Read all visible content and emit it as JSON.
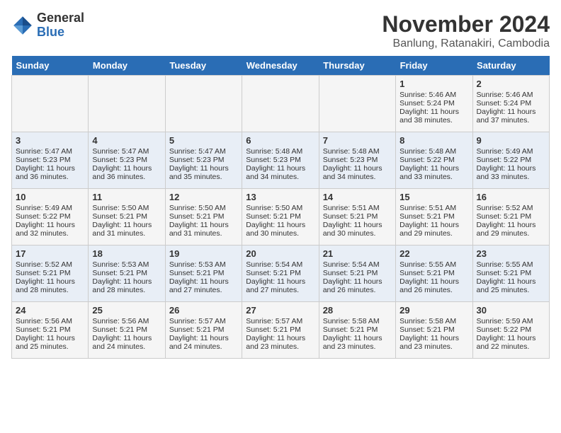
{
  "logo": {
    "general": "General",
    "blue": "Blue"
  },
  "title": "November 2024",
  "subtitle": "Banlung, Ratanakiri, Cambodia",
  "headers": [
    "Sunday",
    "Monday",
    "Tuesday",
    "Wednesday",
    "Thursday",
    "Friday",
    "Saturday"
  ],
  "weeks": [
    [
      {
        "day": "",
        "sunrise": "",
        "sunset": "",
        "daylight": ""
      },
      {
        "day": "",
        "sunrise": "",
        "sunset": "",
        "daylight": ""
      },
      {
        "day": "",
        "sunrise": "",
        "sunset": "",
        "daylight": ""
      },
      {
        "day": "",
        "sunrise": "",
        "sunset": "",
        "daylight": ""
      },
      {
        "day": "",
        "sunrise": "",
        "sunset": "",
        "daylight": ""
      },
      {
        "day": "1",
        "sunrise": "Sunrise: 5:46 AM",
        "sunset": "Sunset: 5:24 PM",
        "daylight": "Daylight: 11 hours and 38 minutes."
      },
      {
        "day": "2",
        "sunrise": "Sunrise: 5:46 AM",
        "sunset": "Sunset: 5:24 PM",
        "daylight": "Daylight: 11 hours and 37 minutes."
      }
    ],
    [
      {
        "day": "3",
        "sunrise": "Sunrise: 5:47 AM",
        "sunset": "Sunset: 5:23 PM",
        "daylight": "Daylight: 11 hours and 36 minutes."
      },
      {
        "day": "4",
        "sunrise": "Sunrise: 5:47 AM",
        "sunset": "Sunset: 5:23 PM",
        "daylight": "Daylight: 11 hours and 36 minutes."
      },
      {
        "day": "5",
        "sunrise": "Sunrise: 5:47 AM",
        "sunset": "Sunset: 5:23 PM",
        "daylight": "Daylight: 11 hours and 35 minutes."
      },
      {
        "day": "6",
        "sunrise": "Sunrise: 5:48 AM",
        "sunset": "Sunset: 5:23 PM",
        "daylight": "Daylight: 11 hours and 34 minutes."
      },
      {
        "day": "7",
        "sunrise": "Sunrise: 5:48 AM",
        "sunset": "Sunset: 5:23 PM",
        "daylight": "Daylight: 11 hours and 34 minutes."
      },
      {
        "day": "8",
        "sunrise": "Sunrise: 5:48 AM",
        "sunset": "Sunset: 5:22 PM",
        "daylight": "Daylight: 11 hours and 33 minutes."
      },
      {
        "day": "9",
        "sunrise": "Sunrise: 5:49 AM",
        "sunset": "Sunset: 5:22 PM",
        "daylight": "Daylight: 11 hours and 33 minutes."
      }
    ],
    [
      {
        "day": "10",
        "sunrise": "Sunrise: 5:49 AM",
        "sunset": "Sunset: 5:22 PM",
        "daylight": "Daylight: 11 hours and 32 minutes."
      },
      {
        "day": "11",
        "sunrise": "Sunrise: 5:50 AM",
        "sunset": "Sunset: 5:21 PM",
        "daylight": "Daylight: 11 hours and 31 minutes."
      },
      {
        "day": "12",
        "sunrise": "Sunrise: 5:50 AM",
        "sunset": "Sunset: 5:21 PM",
        "daylight": "Daylight: 11 hours and 31 minutes."
      },
      {
        "day": "13",
        "sunrise": "Sunrise: 5:50 AM",
        "sunset": "Sunset: 5:21 PM",
        "daylight": "Daylight: 11 hours and 30 minutes."
      },
      {
        "day": "14",
        "sunrise": "Sunrise: 5:51 AM",
        "sunset": "Sunset: 5:21 PM",
        "daylight": "Daylight: 11 hours and 30 minutes."
      },
      {
        "day": "15",
        "sunrise": "Sunrise: 5:51 AM",
        "sunset": "Sunset: 5:21 PM",
        "daylight": "Daylight: 11 hours and 29 minutes."
      },
      {
        "day": "16",
        "sunrise": "Sunrise: 5:52 AM",
        "sunset": "Sunset: 5:21 PM",
        "daylight": "Daylight: 11 hours and 29 minutes."
      }
    ],
    [
      {
        "day": "17",
        "sunrise": "Sunrise: 5:52 AM",
        "sunset": "Sunset: 5:21 PM",
        "daylight": "Daylight: 11 hours and 28 minutes."
      },
      {
        "day": "18",
        "sunrise": "Sunrise: 5:53 AM",
        "sunset": "Sunset: 5:21 PM",
        "daylight": "Daylight: 11 hours and 28 minutes."
      },
      {
        "day": "19",
        "sunrise": "Sunrise: 5:53 AM",
        "sunset": "Sunset: 5:21 PM",
        "daylight": "Daylight: 11 hours and 27 minutes."
      },
      {
        "day": "20",
        "sunrise": "Sunrise: 5:54 AM",
        "sunset": "Sunset: 5:21 PM",
        "daylight": "Daylight: 11 hours and 27 minutes."
      },
      {
        "day": "21",
        "sunrise": "Sunrise: 5:54 AM",
        "sunset": "Sunset: 5:21 PM",
        "daylight": "Daylight: 11 hours and 26 minutes."
      },
      {
        "day": "22",
        "sunrise": "Sunrise: 5:55 AM",
        "sunset": "Sunset: 5:21 PM",
        "daylight": "Daylight: 11 hours and 26 minutes."
      },
      {
        "day": "23",
        "sunrise": "Sunrise: 5:55 AM",
        "sunset": "Sunset: 5:21 PM",
        "daylight": "Daylight: 11 hours and 25 minutes."
      }
    ],
    [
      {
        "day": "24",
        "sunrise": "Sunrise: 5:56 AM",
        "sunset": "Sunset: 5:21 PM",
        "daylight": "Daylight: 11 hours and 25 minutes."
      },
      {
        "day": "25",
        "sunrise": "Sunrise: 5:56 AM",
        "sunset": "Sunset: 5:21 PM",
        "daylight": "Daylight: 11 hours and 24 minutes."
      },
      {
        "day": "26",
        "sunrise": "Sunrise: 5:57 AM",
        "sunset": "Sunset: 5:21 PM",
        "daylight": "Daylight: 11 hours and 24 minutes."
      },
      {
        "day": "27",
        "sunrise": "Sunrise: 5:57 AM",
        "sunset": "Sunset: 5:21 PM",
        "daylight": "Daylight: 11 hours and 23 minutes."
      },
      {
        "day": "28",
        "sunrise": "Sunrise: 5:58 AM",
        "sunset": "Sunset: 5:21 PM",
        "daylight": "Daylight: 11 hours and 23 minutes."
      },
      {
        "day": "29",
        "sunrise": "Sunrise: 5:58 AM",
        "sunset": "Sunset: 5:21 PM",
        "daylight": "Daylight: 11 hours and 23 minutes."
      },
      {
        "day": "30",
        "sunrise": "Sunrise: 5:59 AM",
        "sunset": "Sunset: 5:22 PM",
        "daylight": "Daylight: 11 hours and 22 minutes."
      }
    ]
  ]
}
